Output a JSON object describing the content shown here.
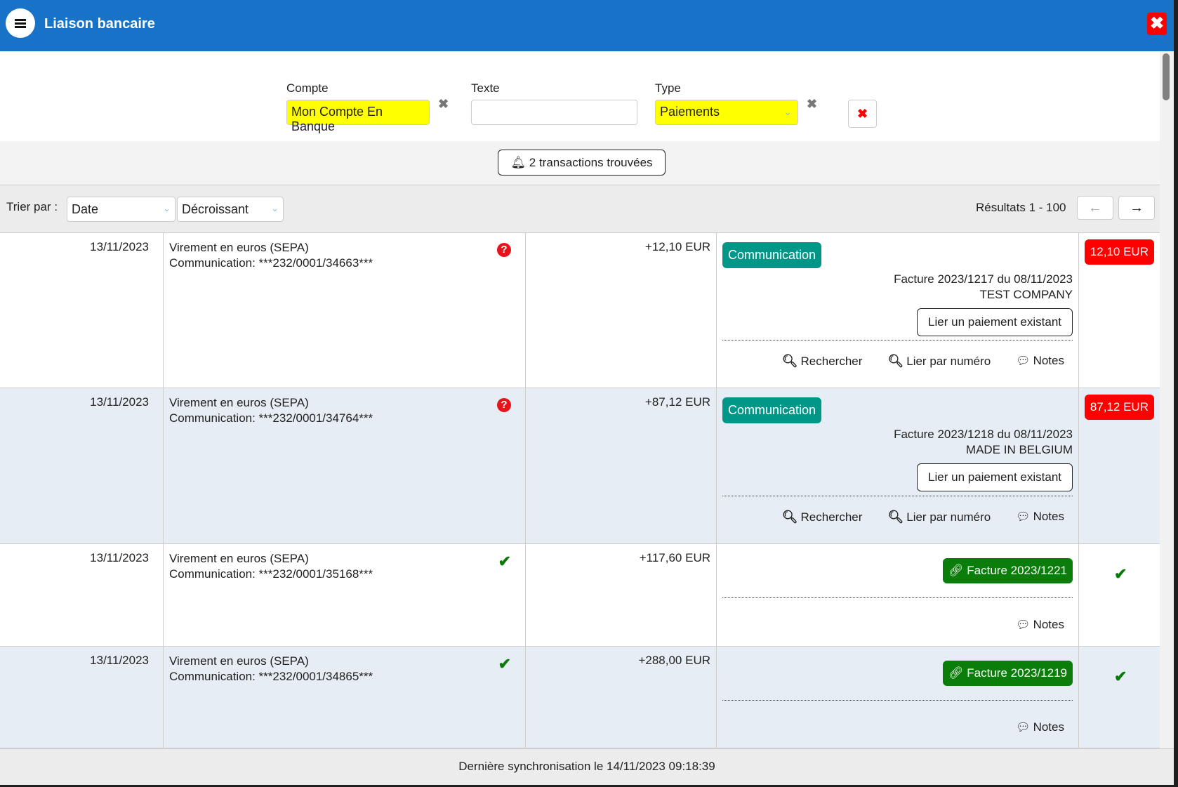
{
  "header": {
    "title": "Liaison bancaire",
    "menu_icon": "hamburger-icon",
    "close_icon": "close-icon"
  },
  "filters": {
    "account": {
      "label": "Compte",
      "value": "Mon Compte En Banque"
    },
    "text": {
      "label": "Texte",
      "value": "",
      "placeholder": ""
    },
    "type": {
      "label": "Type",
      "value": "Paiements"
    },
    "clear_glyph": "✖",
    "reset_glyph": "✖"
  },
  "count": {
    "label": "2 transactions trouvées",
    "icon": "bell-icon"
  },
  "sort": {
    "label": "Trier par :",
    "field": "Date",
    "order": "Décroissant",
    "results": "Résultats 1 - 100",
    "prev_glyph": "🡐",
    "next_glyph": "➔"
  },
  "rows": [
    {
      "date": "13/11/2023",
      "desc1": "Virement en euros (SEPA)",
      "desc2": "Communication: ***232/0001/34663***",
      "status": "question",
      "amount": "+12,10 EUR",
      "badge": "Communication",
      "invoice_line1": "Facture 2023/1217 du 08/11/2023",
      "invoice_line2": "TEST COMPANY",
      "link_button": "Lier un paiement existant",
      "actions": [
        "Rechercher",
        "Lier par numéro",
        "Notes"
      ],
      "remaining": "12,10 EUR"
    },
    {
      "date": "13/11/2023",
      "desc1": "Virement en euros (SEPA)",
      "desc2": "Communication: ***232/0001/34764***",
      "status": "question",
      "amount": "+87,12 EUR",
      "badge": "Communication",
      "invoice_line1": "Facture 2023/1218 du 08/11/2023",
      "invoice_line2": "MADE IN BELGIUM",
      "link_button": "Lier un paiement existant",
      "actions": [
        "Rechercher",
        "Lier par numéro",
        "Notes"
      ],
      "remaining": "87,12 EUR"
    },
    {
      "date": "13/11/2023",
      "desc1": "Virement en euros (SEPA)",
      "desc2": "Communication: ***232/0001/35168***",
      "status": "check",
      "amount": "+117,60 EUR",
      "linked_invoice": "Facture 2023/1221",
      "actions": [
        "Notes"
      ]
    },
    {
      "date": "13/11/2023",
      "desc1": "Virement en euros (SEPA)",
      "desc2": "Communication: ***232/0001/34865***",
      "status": "check",
      "amount": "+288,00 EUR",
      "linked_invoice": "Facture 2023/1219",
      "actions": [
        "Notes"
      ]
    }
  ],
  "footer": {
    "sync": "Dernière synchronisation le 14/11/2023 09:18:39"
  },
  "colors": {
    "header": "#1873c8",
    "close": "#ff0000",
    "highlight": "#ffff00",
    "communication": "#009688",
    "linked": "#0a7d0a",
    "unpaid": "#ff0000"
  }
}
